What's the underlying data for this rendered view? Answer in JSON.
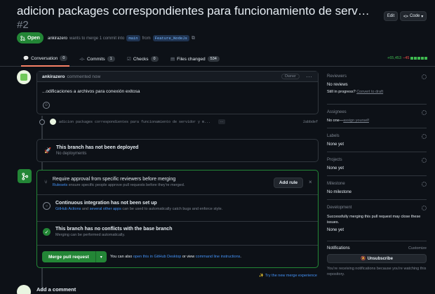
{
  "pr": {
    "title": "adicion packages correspondientes para funcionamiento de servidor y m…",
    "number": "#2",
    "status": "Open",
    "author": "ankirazero",
    "meta_mid": "wants to merge 1 commit into",
    "base_branch": "main",
    "from_word": "from",
    "head_branch": "Feature_NodeJs"
  },
  "actions": {
    "edit": "Edit",
    "code": "Code"
  },
  "tabs": [
    {
      "label": "Conversation",
      "count": "0"
    },
    {
      "label": "Commits",
      "count": "1"
    },
    {
      "label": "Checks",
      "count": "0"
    },
    {
      "label": "Files changed",
      "count": "534"
    }
  ],
  "diffstat": {
    "add": "+65,453",
    "del": "−45"
  },
  "comment": {
    "author": "ankirazero",
    "time": "commented now",
    "role": "Owner",
    "body": "...odificaciones a archivos para conexión exitosa"
  },
  "commit": {
    "message": "adicion packages correspondientes para funcionamiento de servidor y m...",
    "sha": "2abbdef",
    "more": "…"
  },
  "deploy": {
    "title": "This branch has not been deployed",
    "sub": "No deployments"
  },
  "merge": {
    "approval_title": "Require approval from specific reviewers before merging",
    "approval_link": "Rulesets",
    "approval_sub": "ensure specific people approve pull requests before they're merged.",
    "add_rule": "Add rule",
    "ci_title": "Continuous integration has not been set up",
    "ci_link1": "GitHub Actions",
    "ci_and": "and",
    "ci_link2": "several other apps",
    "ci_sub": "can be used to automatically catch bugs and enforce style.",
    "noconf_title": "This branch has no conflicts with the base branch",
    "noconf_sub": "Merging can be performed automatically.",
    "merge_btn": "Merge pull request",
    "also_pre": "You can also",
    "also_link1": "open this in GitHub Desktop",
    "also_mid": "or view",
    "also_link2": "command line instructions",
    "also_end": ".",
    "try_new": "Try the new merge experience"
  },
  "add_comment": "Add a comment",
  "sidebar": {
    "reviewers_h": "Reviewers",
    "reviewers_v": "No reviews",
    "reviewers_progress": "Still in progress?",
    "convert_draft": "Convert to draft",
    "assignees_h": "Assignees",
    "assignees_v": "No one—",
    "assign_yourself": "assign yourself",
    "labels_h": "Labels",
    "labels_v": "None yet",
    "projects_h": "Projects",
    "projects_v": "None yet",
    "milestone_h": "Milestone",
    "milestone_v": "No milestone",
    "development_h": "Development",
    "development_v": "Successfully merging this pull request may close these issues.",
    "development_v2": "None yet",
    "notifications_h": "Notifications",
    "customize": "Customize",
    "unsubscribe": "Unsubscribe",
    "notif_note": "You're receiving notifications because you're watching this repository."
  },
  "colors": {
    "green": "#238636",
    "accent": "#4493f8",
    "danger": "#f85149",
    "success": "#3fb950"
  }
}
